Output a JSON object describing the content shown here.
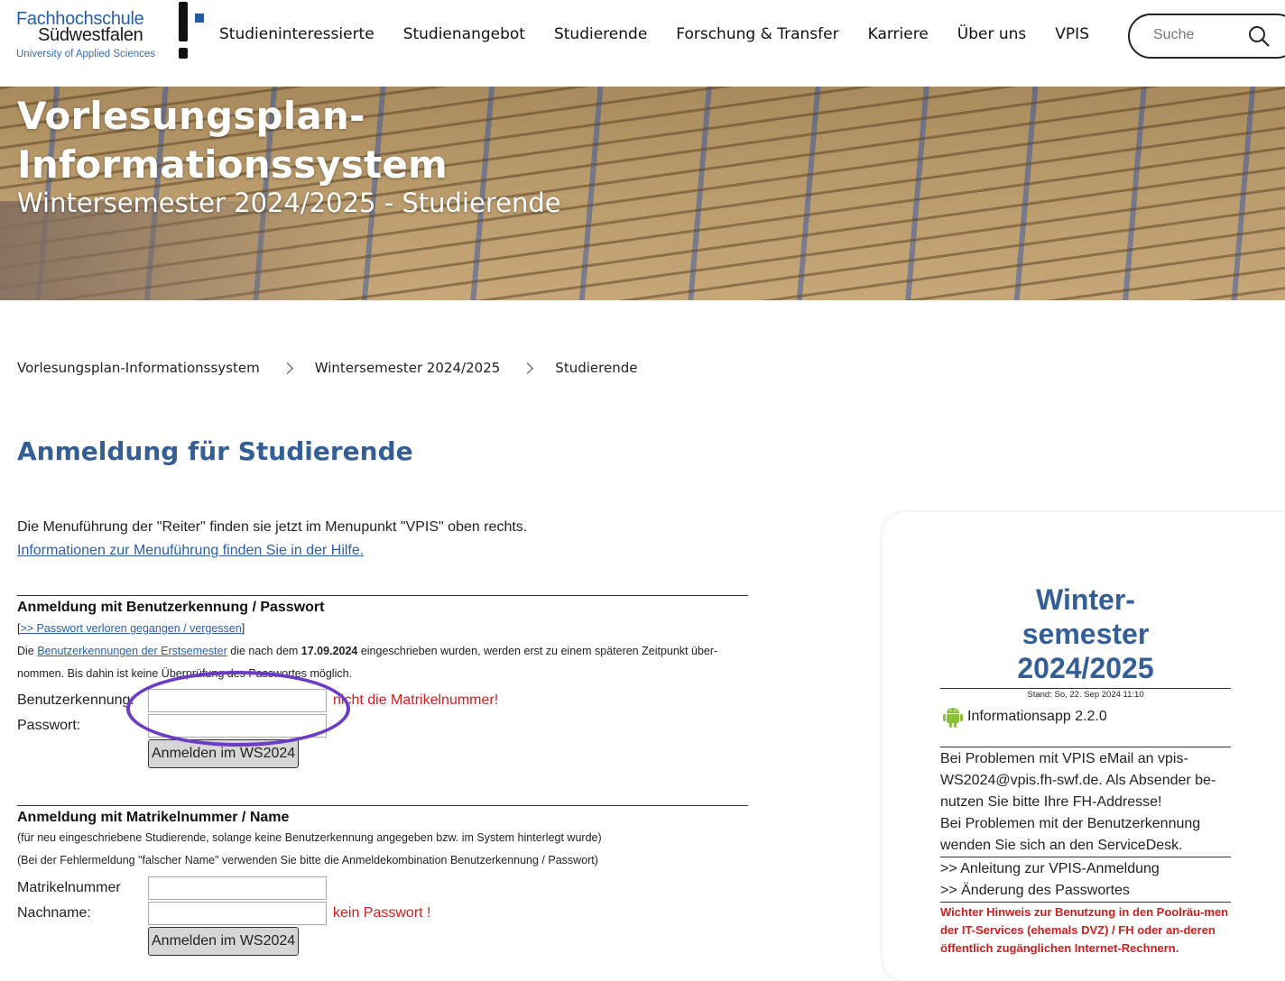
{
  "logo": {
    "line1": "Fachhochschule",
    "line2": "Südwestfalen",
    "line3": "University of Applied Sciences"
  },
  "nav": [
    "Studieninteressierte",
    "Studienangebot",
    "Studierende",
    "Forschung & Transfer",
    "Karriere",
    "Über uns",
    "VPIS"
  ],
  "search": {
    "placeholder": "Suche"
  },
  "hero": {
    "title_line1": "Vorlesungsplan-",
    "title_line2": "Informationssystem",
    "subtitle": "Wintersemester 2024/2025 - Studierende"
  },
  "breadcrumb": [
    "Vorlesungsplan-Informationssystem",
    "Wintersemester 2024/2025",
    "Studierende"
  ],
  "page_title": "Anmeldung für Studierende",
  "intro": {
    "text": "Die Menuführung der \"Reiter\" finden sie jetzt im Menupunkt \"VPIS\" oben rechts.",
    "link": "Informationen zur Menuführung finden Sie in der Hilfe."
  },
  "login_user": {
    "heading": "Anmeldung mit Benutzerkennung / Passwort",
    "forgot_link": ">> Passwort verloren gegangen / vergessen",
    "note_pre": "Die ",
    "note_link": "Benutzerkennungen der Erstsemester",
    "note_mid": " die nach dem ",
    "note_date": "17.09.2024",
    "note_post": " eingeschrieben wurden, werden erst zu einem späteren Zeitpunkt über-",
    "note_line2": "nommen. Bis dahin ist keine Überprüfung des Passwortes möglich.",
    "user_label": "Benutzerkennung:",
    "pass_label": "Passwort:",
    "user_hint": "nicht die Matrikelnummer!",
    "button": "Anmelden im WS2024"
  },
  "login_matr": {
    "heading": "Anmeldung mit Matrikelnummer / Name",
    "note1": "(für neu eingeschriebene Studierende, solange keine Benutzerkennung angegeben bzw. im System hinterlegt wurde)",
    "note2": "(Bei der Fehlermeldung \"falscher Name\" verwenden Sie bitte die Anmeldekombination Benutzerkennung / Passwort)",
    "matr_label": "Matrikelnummer",
    "name_label": "Nachname:",
    "name_hint": "kein Passwort !",
    "button": "Anmelden im WS2024"
  },
  "sidebar": {
    "semester_line1": "Winter-",
    "semester_line2": "semester",
    "semester_line3": "2024/2025",
    "stand": "Stand: So, 22. Sep 2024 11:10",
    "app": "Informationsapp 2.2.0",
    "problem_text": "Bei Problemen mit VPIS eMail an vpis-WS2024@vpis.fh-swf.de. Als Absender be-nutzen Sie bitte Ihre FH-Addresse!",
    "problem_text2": "Bei Problemen mit der Benutzerkennung wenden Sie sich an den ServiceDesk.",
    "link1": ">> Anleitung zur VPIS-Anmeldung",
    "link2": ">> Änderung des Passwortes",
    "red_note": "Wichter Hinweis zur Benutzung in den Poolräu-men der IT-Services (ehemals DVZ) / FH oder an-deren öffentlich zugänglichen Internet-Rechnern."
  },
  "colors": {
    "brand_blue": "#335e96",
    "warning_red": "#cc1f1f",
    "annotation_purple": "#6d3cc6"
  }
}
